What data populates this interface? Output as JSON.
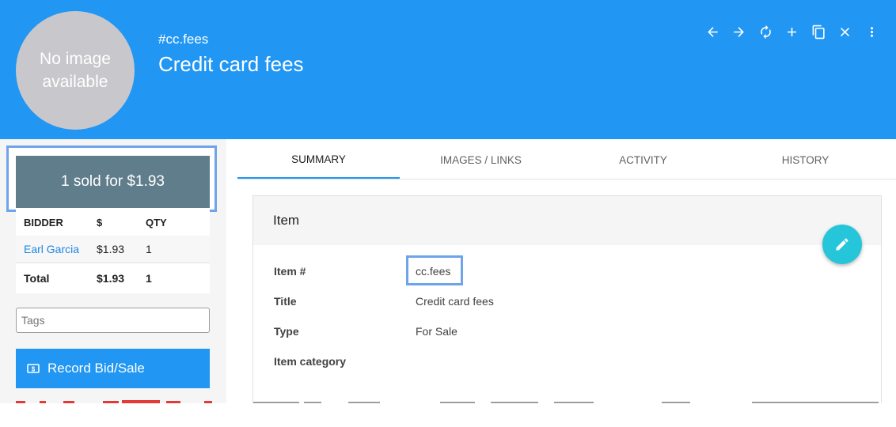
{
  "header": {
    "avatar_text": "No image available",
    "item_code": "#cc.fees",
    "title": "Credit card fees"
  },
  "toolbar": {
    "icons": [
      "arrow-back-icon",
      "arrow-forward-icon",
      "refresh-icon",
      "add-icon",
      "copy-icon",
      "close-icon",
      "more-vert-icon"
    ]
  },
  "sidebar": {
    "sold_summary": "1 sold for $1.93",
    "bids_table": {
      "headers": [
        "BIDDER",
        "$",
        "QTY"
      ],
      "rows": [
        {
          "bidder": "Earl Garcia",
          "amount": "$1.93",
          "qty": "1"
        }
      ],
      "total": {
        "label": "Total",
        "amount": "$1.93",
        "qty": "1"
      }
    },
    "tags_placeholder": "Tags",
    "record_button": "Record Bid/Sale"
  },
  "tabs": [
    {
      "label": "SUMMARY",
      "active": true
    },
    {
      "label": "IMAGES / LINKS",
      "active": false
    },
    {
      "label": "ACTIVITY",
      "active": false
    },
    {
      "label": "HISTORY",
      "active": false
    }
  ],
  "card": {
    "title": "Item",
    "fields": [
      {
        "label": "Item #",
        "value": "cc.fees"
      },
      {
        "label": "Title",
        "value": "Credit card fees"
      },
      {
        "label": "Type",
        "value": "For Sale"
      },
      {
        "label": "Item category",
        "value": ""
      }
    ]
  },
  "colors": {
    "primary": "#2196f3",
    "sold_box": "#607d8b",
    "fab": "#26c6da",
    "highlight": "#6fa3ea"
  }
}
